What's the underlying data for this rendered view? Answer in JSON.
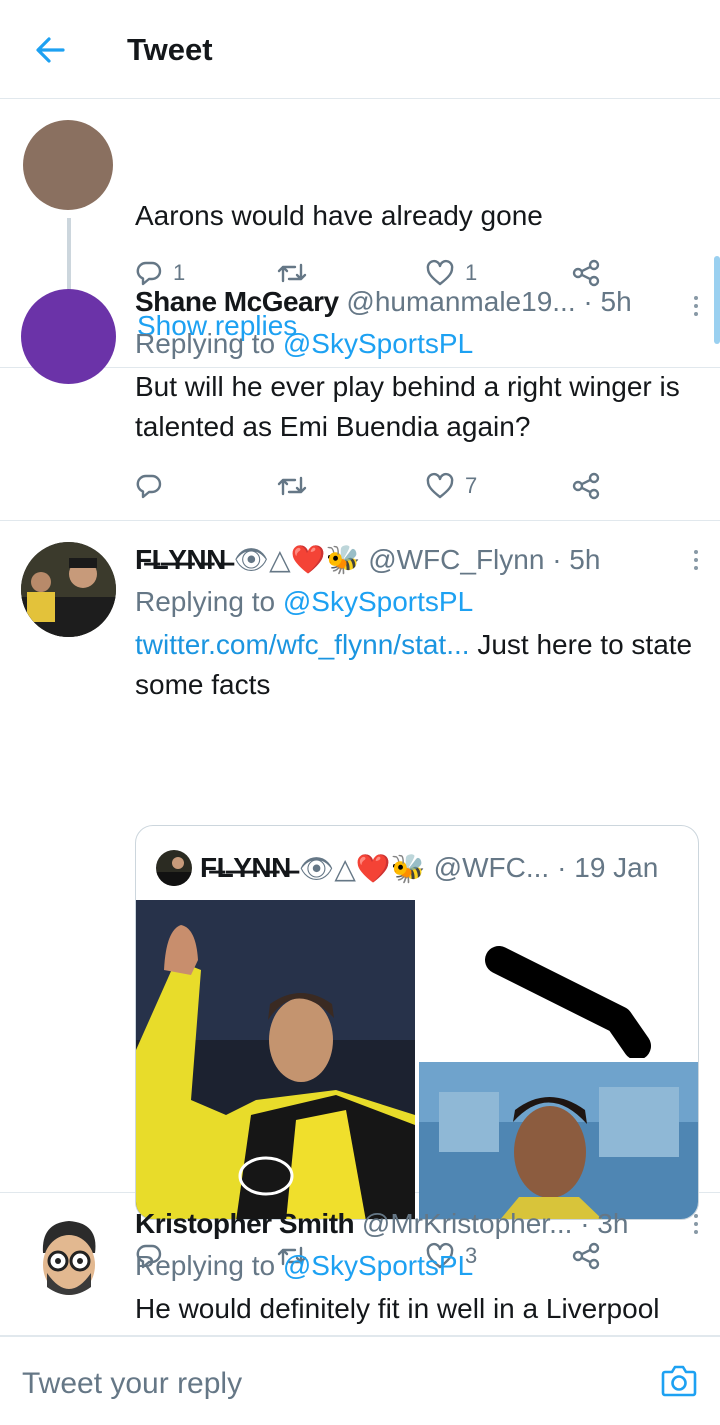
{
  "header": {
    "title": "Tweet"
  },
  "tweet0": {
    "text": "Aarons would have already gone",
    "reply_count": "1",
    "like_count": "1",
    "show_replies": "Show replies"
  },
  "tweet1": {
    "name": "Shane McGeary",
    "handle": "@humanmale19...",
    "time": "· 5h",
    "replying_prefix": "Replying to",
    "replying_to": "@SkySportsPL",
    "text": "But will he ever play behind a right winger is talented as Emi Buendia again?",
    "reply_count": "",
    "like_count": "7",
    "avatar_color": "#6b33a8"
  },
  "tweet2": {
    "name": "F̶L̶Y̶N̶N̶",
    "emoji": "👁△❤️🐝",
    "handle": "@WFC_Flynn",
    "time": "· 5h",
    "replying_prefix": "Replying to",
    "replying_to": "@SkySportsPL",
    "link": "twitter.com/wfc_flynn/stat...",
    "text": " Just here to state some facts",
    "reply_count": "",
    "like_count": "3",
    "quote": {
      "name": "F̶L̶Y̶N̶N̶",
      "emoji": "👁△❤️🐝",
      "handle": "@WFC...",
      "time": "· 19 Jan"
    }
  },
  "tweet3": {
    "name": "Kristopher Smith",
    "handle": "@MrKristopher...",
    "time": "· 3h",
    "replying_prefix": "Replying to",
    "replying_to": "@SkySportsPL",
    "text": "He would definitely fit in well in a Liverpool"
  },
  "reply_bar": {
    "placeholder": "Tweet your reply"
  },
  "colors": {
    "accent": "#1da1f2",
    "muted": "#657786",
    "border": "#e1e8ed"
  },
  "icons": [
    "back-arrow-icon",
    "reply-icon",
    "retweet-icon",
    "like-icon",
    "share-icon",
    "more-icon",
    "camera-icon"
  ]
}
